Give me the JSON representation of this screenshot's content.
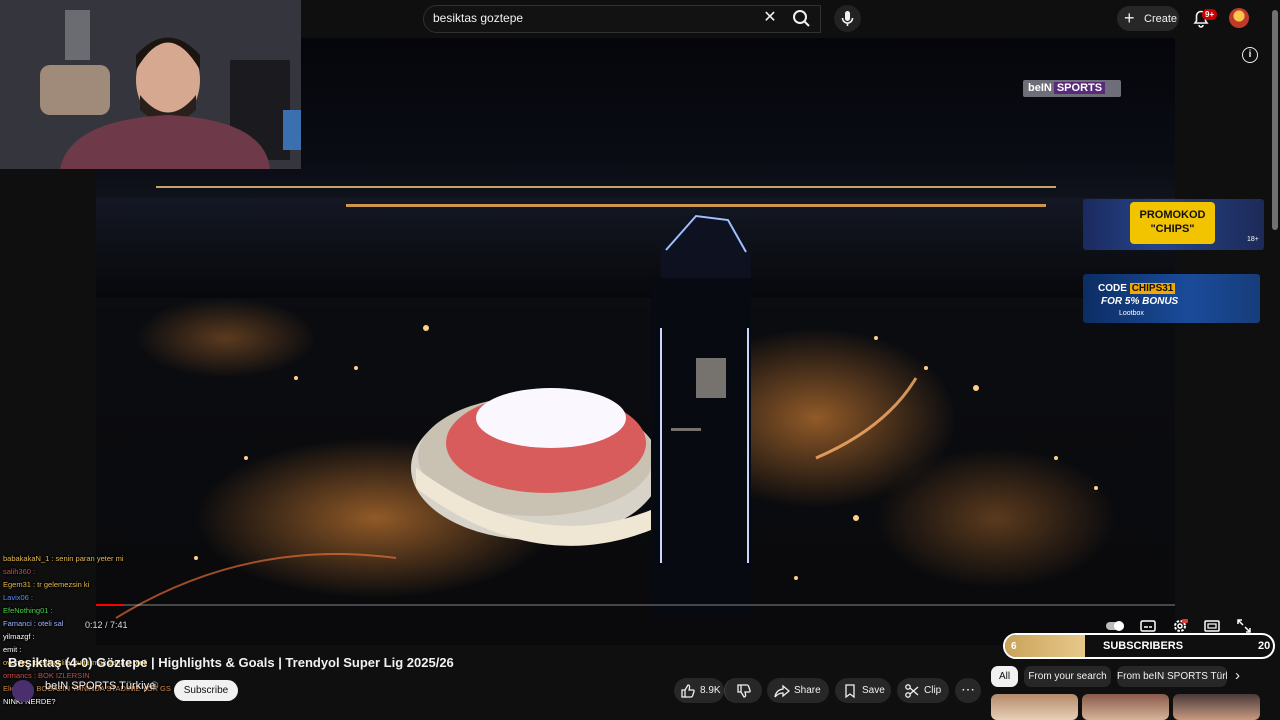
{
  "header": {
    "search_query": "besiktas goztepe",
    "create_label": "Create",
    "notification_count": "9+"
  },
  "overlay": {
    "broadcaster_logo": "beIN",
    "broadcaster_logo_suffix": "SPORTS",
    "ad_promo_text": "PROMOKOD",
    "ad_promo_chips": "\"CHIPS\"",
    "ad_code_text": "CODE",
    "ad_code_value": "CHIPS31",
    "ad_code_bonus": "FOR 5% BONUS",
    "ad_code_brand": "Lootbox",
    "ad_age": "18+"
  },
  "chat": [
    {
      "user": "",
      "text": "babakakaN_1 : senin paran yeter mi",
      "color": "#e6b84a"
    },
    {
      "user": "",
      "text": "salih360 :",
      "color": "#d24a4a"
    },
    {
      "user": "",
      "text": "Egem31 : tr gelemezsin ki",
      "color": "#e6b84a"
    },
    {
      "user": "",
      "text": "Lavix06 :",
      "color": "#5a8cff"
    },
    {
      "user": "",
      "text": "EfeNothing01 :",
      "color": "#4ad24a"
    },
    {
      "user": "",
      "text": "Famanci : oteli sal",
      "color": "#9fb4ff"
    },
    {
      "user": "",
      "text": "yilmazgf :",
      "color": "#ffffff"
    },
    {
      "user": "",
      "text": "emit :",
      "color": "#ffffff"
    },
    {
      "user": "",
      "text": "overyet : besiktaslilar tutturmaz zana o oteli",
      "color": "#e6b84a"
    },
    {
      "user": "",
      "text": "ormancs : BOK IZLERSIN",
      "color": "#d24a4a"
    },
    {
      "user": "",
      "text": "Eliekurtt : BOGAZIN YANINDA STADINIZ YOK GS",
      "color": "#d2884a"
    },
    {
      "user": "",
      "text": "NINKI NERDE?",
      "color": "#ffffff"
    }
  ],
  "player": {
    "time": "0:12 / 7:41",
    "progress": 0.026
  },
  "subscribers_goal": {
    "current": "6",
    "label": "SUBSCRIBERS",
    "goal": "20",
    "fill_fraction": 0.3
  },
  "video": {
    "title": "Beşiktaş (4-0) Göztepe | Highlights & Goals | Trendyol Super Lig 2025/26",
    "channel": "beIN SPORTS Türkiye",
    "subscribe_label": "Subscribe",
    "likes": "8.9K",
    "share_label": "Share",
    "save_label": "Save",
    "clip_label": "Clip"
  },
  "related": {
    "chips": [
      "All",
      "From your search",
      "From beIN SPORTS Türkiye"
    ]
  }
}
